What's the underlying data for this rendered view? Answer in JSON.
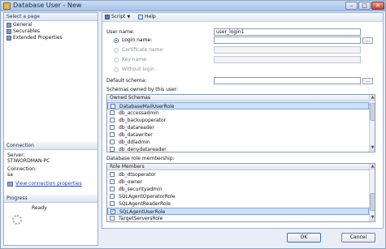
{
  "window": {
    "title": "Database User - New"
  },
  "left_pane": {
    "select_page_header": "Select a page",
    "pages": [
      {
        "label": "General",
        "icon": "page-icon"
      },
      {
        "label": "Securables",
        "icon": "page-icon"
      },
      {
        "label": "Extended Properties",
        "icon": "page-icon"
      }
    ],
    "connection_header": "Connection",
    "server_label": "Server:",
    "server_value": "STIWORDMAN-PC",
    "connection_label": "Connection:",
    "connection_value": "sa",
    "view_connection_link": "View connection properties",
    "progress_header": "Progress",
    "progress_status": "Ready"
  },
  "toolbar": {
    "script_label": "Script",
    "help_label": "Help"
  },
  "form": {
    "user_name_label": "User name:",
    "user_name_value": "user_login1",
    "login_name_label": "Login name:",
    "login_name_value": "",
    "certificate_name_label": "Certificate name:",
    "key_name_label": "Key name:",
    "without_login_label": "Without login",
    "default_schema_label": "Default schema:",
    "default_schema_value": "",
    "browse_label": "..."
  },
  "schemas": {
    "section_label": "Schemas owned by this user:",
    "column_header": "Owned Schemas",
    "rows": [
      {
        "name": "DatabaseMailUserRole",
        "checked": false
      },
      {
        "name": "db_accessadmin",
        "checked": false
      },
      {
        "name": "db_backupoperator",
        "checked": false
      },
      {
        "name": "db_datareader",
        "checked": false
      },
      {
        "name": "db_datawriter",
        "checked": false
      },
      {
        "name": "db_ddladmin",
        "checked": false
      },
      {
        "name": "db_denydatareader",
        "checked": false
      }
    ]
  },
  "roles": {
    "section_label": "Database role membership:",
    "column_header": "Role Members",
    "rows": [
      {
        "name": "db_dtsoperator",
        "checked": false
      },
      {
        "name": "db_owner",
        "checked": false
      },
      {
        "name": "db_securityadmin",
        "checked": false
      },
      {
        "name": "SQLAgentOperatorRole",
        "checked": false
      },
      {
        "name": "SQLAgentReaderRole",
        "checked": false
      },
      {
        "name": "SQLAgentUserRole",
        "checked": true
      },
      {
        "name": "TargetServersRole",
        "checked": false
      }
    ]
  },
  "buttons": {
    "ok_label": "OK",
    "cancel_label": "Cancel"
  }
}
